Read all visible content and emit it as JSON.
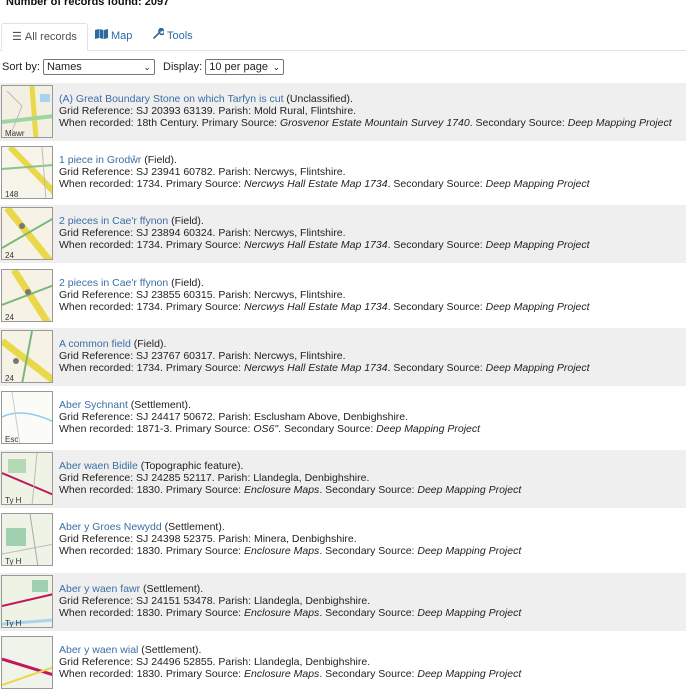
{
  "header": {
    "records_found": "Number of records found: 2097"
  },
  "tabs": [
    {
      "label": "All records",
      "icon": "list-icon",
      "active": true
    },
    {
      "label": "Map",
      "icon": "map-icon",
      "active": false
    },
    {
      "label": "Tools",
      "icon": "wrench-icon",
      "active": false
    }
  ],
  "controls": {
    "sort_label": "Sort by:",
    "sort_value": "Names",
    "display_label": "Display:",
    "display_value": "10 per page"
  },
  "labels": {
    "grid": "Grid Reference: ",
    "parish": ". Parish: ",
    "when": "When recorded: ",
    "primary": ". Primary Source: ",
    "secondary": ". Secondary Source: "
  },
  "records": [
    {
      "name": "(A) Great Boundary Stone on which Tarfyn is cut",
      "type": " (Unclassified).",
      "grid": "SJ 20393 63139",
      "parish": "Mold Rural, Flintshire",
      "when": "18th Century",
      "primary": "Grosvenor Estate Mountain Survey 1740",
      "secondary": "Deep Mapping Project"
    },
    {
      "name": "1 piece in Grodŵr",
      "type": " (Field).",
      "grid": "SJ 23941 60782",
      "parish": "Nercwys, Flintshire",
      "when": "1734",
      "primary": "Nercwys Hall Estate Map 1734",
      "secondary": "Deep Mapping Project"
    },
    {
      "name": "2 pieces in Cae'r ffynon",
      "type": " (Field).",
      "grid": "SJ 23894 60324",
      "parish": "Nercwys, Flintshire",
      "when": "1734",
      "primary": "Nercwys Hall Estate Map 1734",
      "secondary": "Deep Mapping Project"
    },
    {
      "name": "2 pieces in Cae'r ffynon",
      "type": " (Field).",
      "grid": "SJ 23855 60315",
      "parish": "Nercwys, Flintshire",
      "when": "1734",
      "primary": "Nercwys Hall Estate Map 1734",
      "secondary": "Deep Mapping Project"
    },
    {
      "name": "A common field",
      "type": " (Field).",
      "grid": "SJ 23767 60317",
      "parish": "Nercwys, Flintshire",
      "when": "1734",
      "primary": "Nercwys Hall Estate Map 1734",
      "secondary": "Deep Mapping Project"
    },
    {
      "name": "Aber Sychnant",
      "type": " (Settlement).",
      "grid": "SJ 24417 50672",
      "parish": "Esclusham Above, Denbighshire",
      "when": "1871-3",
      "primary": "OS6\"",
      "secondary": "Deep Mapping Project"
    },
    {
      "name": "Aber waen Bidile",
      "type": " (Topographic feature).",
      "grid": "SJ 24285 52117",
      "parish": "Llandegla, Denbighshire",
      "when": "1830",
      "primary": "Enclosure Maps",
      "secondary": "Deep Mapping Project"
    },
    {
      "name": "Aber y Groes Newydd",
      "type": " (Settlement).",
      "grid": "SJ 24398 52375",
      "parish": "Minera, Denbighshire",
      "when": "1830",
      "primary": "Enclosure Maps",
      "secondary": "Deep Mapping Project"
    },
    {
      "name": "Aber y waen fawr",
      "type": " (Settlement).",
      "grid": "SJ 24151 53478",
      "parish": "Llandegla, Denbighshire",
      "when": "1830",
      "primary": "Enclosure Maps",
      "secondary": "Deep Mapping Project"
    },
    {
      "name": "Aber y waen wial",
      "type": " (Settlement).",
      "grid": "SJ 24496 52855",
      "parish": "Llandegla, Denbighshire",
      "when": "1830",
      "primary": "Enclosure Maps",
      "secondary": "Deep Mapping Project"
    }
  ],
  "thumb_text": [
    "Mawr",
    "148",
    "24",
    "24",
    "24",
    "Esc",
    "Ty H",
    "Ty H",
    "Ty H",
    ""
  ],
  "colors": {
    "link": "#3b6ea5",
    "row_alt": "#efefef",
    "map_yellow": "#e8d84a",
    "map_pink": "#c2185b"
  }
}
